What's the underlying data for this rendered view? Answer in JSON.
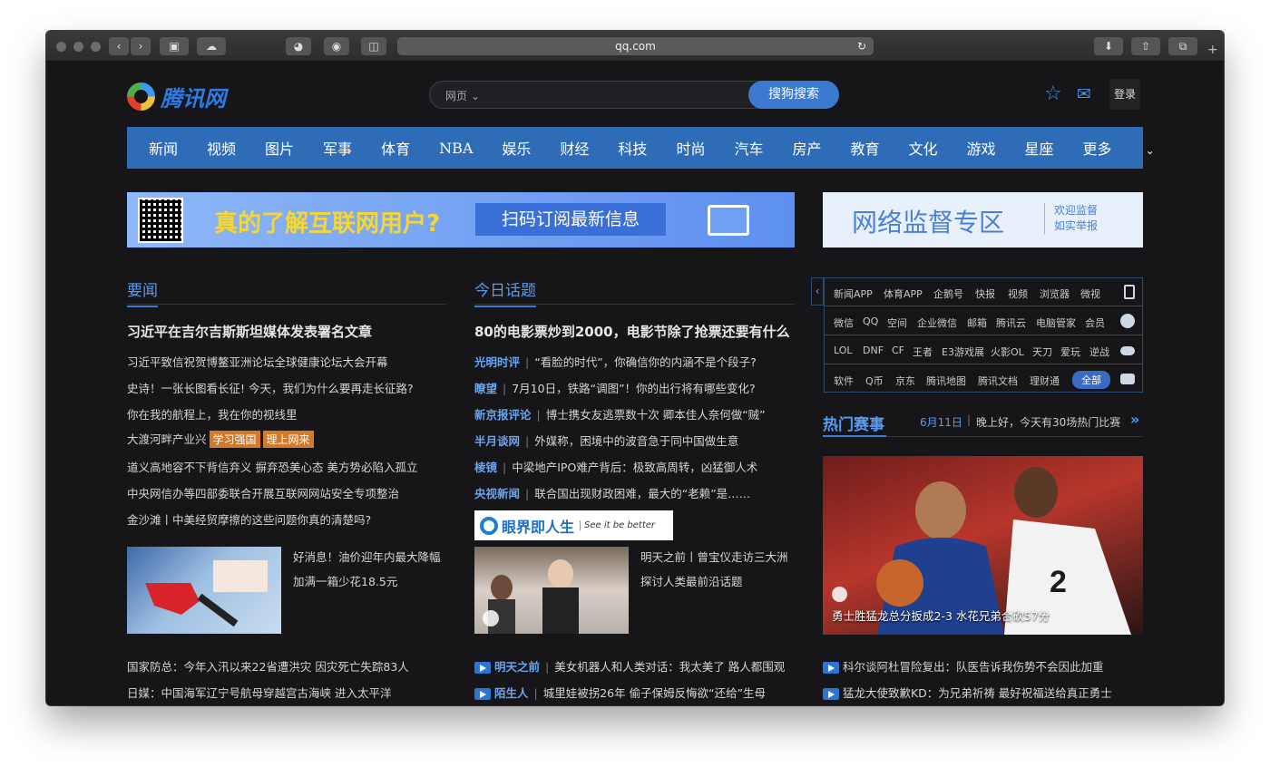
{
  "browser": {
    "url": "qq.com"
  },
  "header": {
    "logo_text": "腾讯网",
    "search_scope": "网页",
    "search_button": "搜狗搜索",
    "login": "登录"
  },
  "nav": [
    "新闻",
    "视频",
    "图片",
    "军事",
    "体育",
    "NBA",
    "娱乐",
    "财经",
    "科技",
    "时尚",
    "汽车",
    "房产",
    "教育",
    "文化",
    "游戏",
    "星座",
    "更多"
  ],
  "banners": {
    "left_title": "真的了解互联网用户?",
    "left_sub": "扫码订阅最新信息",
    "right_title": "网络监督专区",
    "right_sub1": "欢迎监督",
    "right_sub2": "如实举报"
  },
  "yaowen": {
    "title": "要闻",
    "headline": "习近平在吉尔吉斯斯坦媒体发表署名文章",
    "items": [
      "习近平致信祝贺博鳌亚洲论坛全球健康论坛大会开幕",
      "史诗！一张长图看长征! 今天，我们为什么要再走长征路?",
      "你在我的航程上，我在你的视线里",
      "大渡河畔产业兴",
      "道义高地容不下背信弃义 摒弃恐美心态 美方势必陷入孤立",
      "中央网信办等四部委联合开展互联网网站安全专项整治",
      "金沙滩丨中美经贸摩擦的这些问题你真的清楚吗?"
    ],
    "tags": [
      "学习强国",
      "理上网来"
    ],
    "feature_text1": "好消息！油价迎年内最大降幅",
    "feature_text2": "加满一箱少花18.5元",
    "bottom": [
      "国家防总：今年入汛以来22省遭洪灾 因灾死亡失踪83人",
      "日媒：中国海军辽宁号航母穿越宫古海峡 进入太平洋"
    ]
  },
  "jinri": {
    "title": "今日话题",
    "headline": "80的电影票炒到2000，电影节除了抢票还要有什么",
    "items": [
      {
        "src": "光明时评",
        "text": "“看脸的时代”，你确信你的内涵不是个段子?"
      },
      {
        "src": "瞭望",
        "text": "7月10日，铁路“调图”！你的出行将有哪些变化?"
      },
      {
        "src": "新京报评论",
        "text": "博士携女友逃票数十次 卿本佳人奈何做“贼”"
      },
      {
        "src": "半月谈网",
        "text": "外媒称，困境中的波音急于同中国做生意"
      },
      {
        "src": "棱镜",
        "text": "中梁地产IPO难产背后：极致高周转，凶猛御人术"
      },
      {
        "src": "央视新闻",
        "text": "联合国出现财政困难，最大的“老赖”是……"
      }
    ],
    "promo_title": "眼界即人生",
    "promo_slogan": "See it be better",
    "feature_text1": "明天之前丨曾宝仪走访三大洲",
    "feature_text2": "探讨人类最前沿话题",
    "bottom": [
      {
        "src": "明天之前",
        "text": "美女机器人和人类对话：我太美了 路人都围观"
      },
      {
        "src": "陌生人",
        "text": "城里娃被拐26年 偷子保姆反悔欲“还给”生母"
      }
    ]
  },
  "services": {
    "rows": [
      [
        "新闻APP",
        "体育APP",
        "企鹅号",
        "快报",
        "视频",
        "浏览器",
        "微视"
      ],
      [
        "微信",
        "QQ",
        "空间",
        "企业微信",
        "邮箱",
        "腾讯云",
        "电脑管家",
        "会员"
      ],
      [
        "LOL",
        "DNF",
        "CF",
        "王者",
        "E3游戏展",
        "火影OL",
        "天刀",
        "爱玩",
        "逆战"
      ],
      [
        "软件",
        "Q币",
        "京东",
        "腾讯地图",
        "腾讯文档",
        "理财通"
      ]
    ],
    "all_label": "全部"
  },
  "hot": {
    "title": "热门赛事",
    "date": "6月11日",
    "text": "晚上好，今天有30场热门比赛",
    "image_caption": "勇士胜猛龙总分扳成2-3 水花兄弟合砍57分",
    "bottom": [
      "科尔谈阿杜冒险复出：队医告诉我伤势不会因此加重",
      "猛龙大使致歉KD：为兄弟祈祷 最好祝福送给真正勇士"
    ]
  }
}
